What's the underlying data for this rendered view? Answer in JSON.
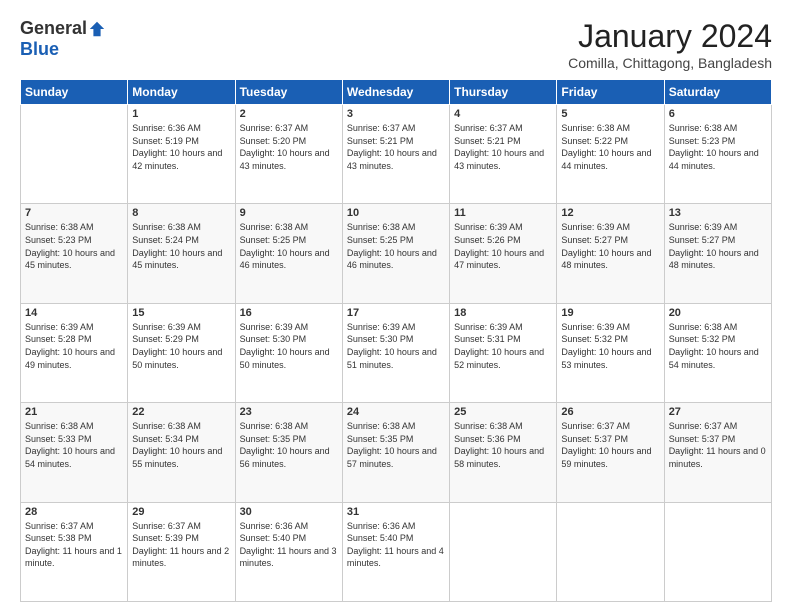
{
  "header": {
    "logo_general": "General",
    "logo_blue": "Blue",
    "month_title": "January 2024",
    "location": "Comilla, Chittagong, Bangladesh"
  },
  "weekdays": [
    "Sunday",
    "Monday",
    "Tuesday",
    "Wednesday",
    "Thursday",
    "Friday",
    "Saturday"
  ],
  "weeks": [
    [
      {
        "day": "",
        "sunrise": "",
        "sunset": "",
        "daylight": ""
      },
      {
        "day": "1",
        "sunrise": "Sunrise: 6:36 AM",
        "sunset": "Sunset: 5:19 PM",
        "daylight": "Daylight: 10 hours and 42 minutes."
      },
      {
        "day": "2",
        "sunrise": "Sunrise: 6:37 AM",
        "sunset": "Sunset: 5:20 PM",
        "daylight": "Daylight: 10 hours and 43 minutes."
      },
      {
        "day": "3",
        "sunrise": "Sunrise: 6:37 AM",
        "sunset": "Sunset: 5:21 PM",
        "daylight": "Daylight: 10 hours and 43 minutes."
      },
      {
        "day": "4",
        "sunrise": "Sunrise: 6:37 AM",
        "sunset": "Sunset: 5:21 PM",
        "daylight": "Daylight: 10 hours and 43 minutes."
      },
      {
        "day": "5",
        "sunrise": "Sunrise: 6:38 AM",
        "sunset": "Sunset: 5:22 PM",
        "daylight": "Daylight: 10 hours and 44 minutes."
      },
      {
        "day": "6",
        "sunrise": "Sunrise: 6:38 AM",
        "sunset": "Sunset: 5:23 PM",
        "daylight": "Daylight: 10 hours and 44 minutes."
      }
    ],
    [
      {
        "day": "7",
        "sunrise": "Sunrise: 6:38 AM",
        "sunset": "Sunset: 5:23 PM",
        "daylight": "Daylight: 10 hours and 45 minutes."
      },
      {
        "day": "8",
        "sunrise": "Sunrise: 6:38 AM",
        "sunset": "Sunset: 5:24 PM",
        "daylight": "Daylight: 10 hours and 45 minutes."
      },
      {
        "day": "9",
        "sunrise": "Sunrise: 6:38 AM",
        "sunset": "Sunset: 5:25 PM",
        "daylight": "Daylight: 10 hours and 46 minutes."
      },
      {
        "day": "10",
        "sunrise": "Sunrise: 6:38 AM",
        "sunset": "Sunset: 5:25 PM",
        "daylight": "Daylight: 10 hours and 46 minutes."
      },
      {
        "day": "11",
        "sunrise": "Sunrise: 6:39 AM",
        "sunset": "Sunset: 5:26 PM",
        "daylight": "Daylight: 10 hours and 47 minutes."
      },
      {
        "day": "12",
        "sunrise": "Sunrise: 6:39 AM",
        "sunset": "Sunset: 5:27 PM",
        "daylight": "Daylight: 10 hours and 48 minutes."
      },
      {
        "day": "13",
        "sunrise": "Sunrise: 6:39 AM",
        "sunset": "Sunset: 5:27 PM",
        "daylight": "Daylight: 10 hours and 48 minutes."
      }
    ],
    [
      {
        "day": "14",
        "sunrise": "Sunrise: 6:39 AM",
        "sunset": "Sunset: 5:28 PM",
        "daylight": "Daylight: 10 hours and 49 minutes."
      },
      {
        "day": "15",
        "sunrise": "Sunrise: 6:39 AM",
        "sunset": "Sunset: 5:29 PM",
        "daylight": "Daylight: 10 hours and 50 minutes."
      },
      {
        "day": "16",
        "sunrise": "Sunrise: 6:39 AM",
        "sunset": "Sunset: 5:30 PM",
        "daylight": "Daylight: 10 hours and 50 minutes."
      },
      {
        "day": "17",
        "sunrise": "Sunrise: 6:39 AM",
        "sunset": "Sunset: 5:30 PM",
        "daylight": "Daylight: 10 hours and 51 minutes."
      },
      {
        "day": "18",
        "sunrise": "Sunrise: 6:39 AM",
        "sunset": "Sunset: 5:31 PM",
        "daylight": "Daylight: 10 hours and 52 minutes."
      },
      {
        "day": "19",
        "sunrise": "Sunrise: 6:39 AM",
        "sunset": "Sunset: 5:32 PM",
        "daylight": "Daylight: 10 hours and 53 minutes."
      },
      {
        "day": "20",
        "sunrise": "Sunrise: 6:38 AM",
        "sunset": "Sunset: 5:32 PM",
        "daylight": "Daylight: 10 hours and 54 minutes."
      }
    ],
    [
      {
        "day": "21",
        "sunrise": "Sunrise: 6:38 AM",
        "sunset": "Sunset: 5:33 PM",
        "daylight": "Daylight: 10 hours and 54 minutes."
      },
      {
        "day": "22",
        "sunrise": "Sunrise: 6:38 AM",
        "sunset": "Sunset: 5:34 PM",
        "daylight": "Daylight: 10 hours and 55 minutes."
      },
      {
        "day": "23",
        "sunrise": "Sunrise: 6:38 AM",
        "sunset": "Sunset: 5:35 PM",
        "daylight": "Daylight: 10 hours and 56 minutes."
      },
      {
        "day": "24",
        "sunrise": "Sunrise: 6:38 AM",
        "sunset": "Sunset: 5:35 PM",
        "daylight": "Daylight: 10 hours and 57 minutes."
      },
      {
        "day": "25",
        "sunrise": "Sunrise: 6:38 AM",
        "sunset": "Sunset: 5:36 PM",
        "daylight": "Daylight: 10 hours and 58 minutes."
      },
      {
        "day": "26",
        "sunrise": "Sunrise: 6:37 AM",
        "sunset": "Sunset: 5:37 PM",
        "daylight": "Daylight: 10 hours and 59 minutes."
      },
      {
        "day": "27",
        "sunrise": "Sunrise: 6:37 AM",
        "sunset": "Sunset: 5:37 PM",
        "daylight": "Daylight: 11 hours and 0 minutes."
      }
    ],
    [
      {
        "day": "28",
        "sunrise": "Sunrise: 6:37 AM",
        "sunset": "Sunset: 5:38 PM",
        "daylight": "Daylight: 11 hours and 1 minute."
      },
      {
        "day": "29",
        "sunrise": "Sunrise: 6:37 AM",
        "sunset": "Sunset: 5:39 PM",
        "daylight": "Daylight: 11 hours and 2 minutes."
      },
      {
        "day": "30",
        "sunrise": "Sunrise: 6:36 AM",
        "sunset": "Sunset: 5:40 PM",
        "daylight": "Daylight: 11 hours and 3 minutes."
      },
      {
        "day": "31",
        "sunrise": "Sunrise: 6:36 AM",
        "sunset": "Sunset: 5:40 PM",
        "daylight": "Daylight: 11 hours and 4 minutes."
      },
      {
        "day": "",
        "sunrise": "",
        "sunset": "",
        "daylight": ""
      },
      {
        "day": "",
        "sunrise": "",
        "sunset": "",
        "daylight": ""
      },
      {
        "day": "",
        "sunrise": "",
        "sunset": "",
        "daylight": ""
      }
    ]
  ]
}
